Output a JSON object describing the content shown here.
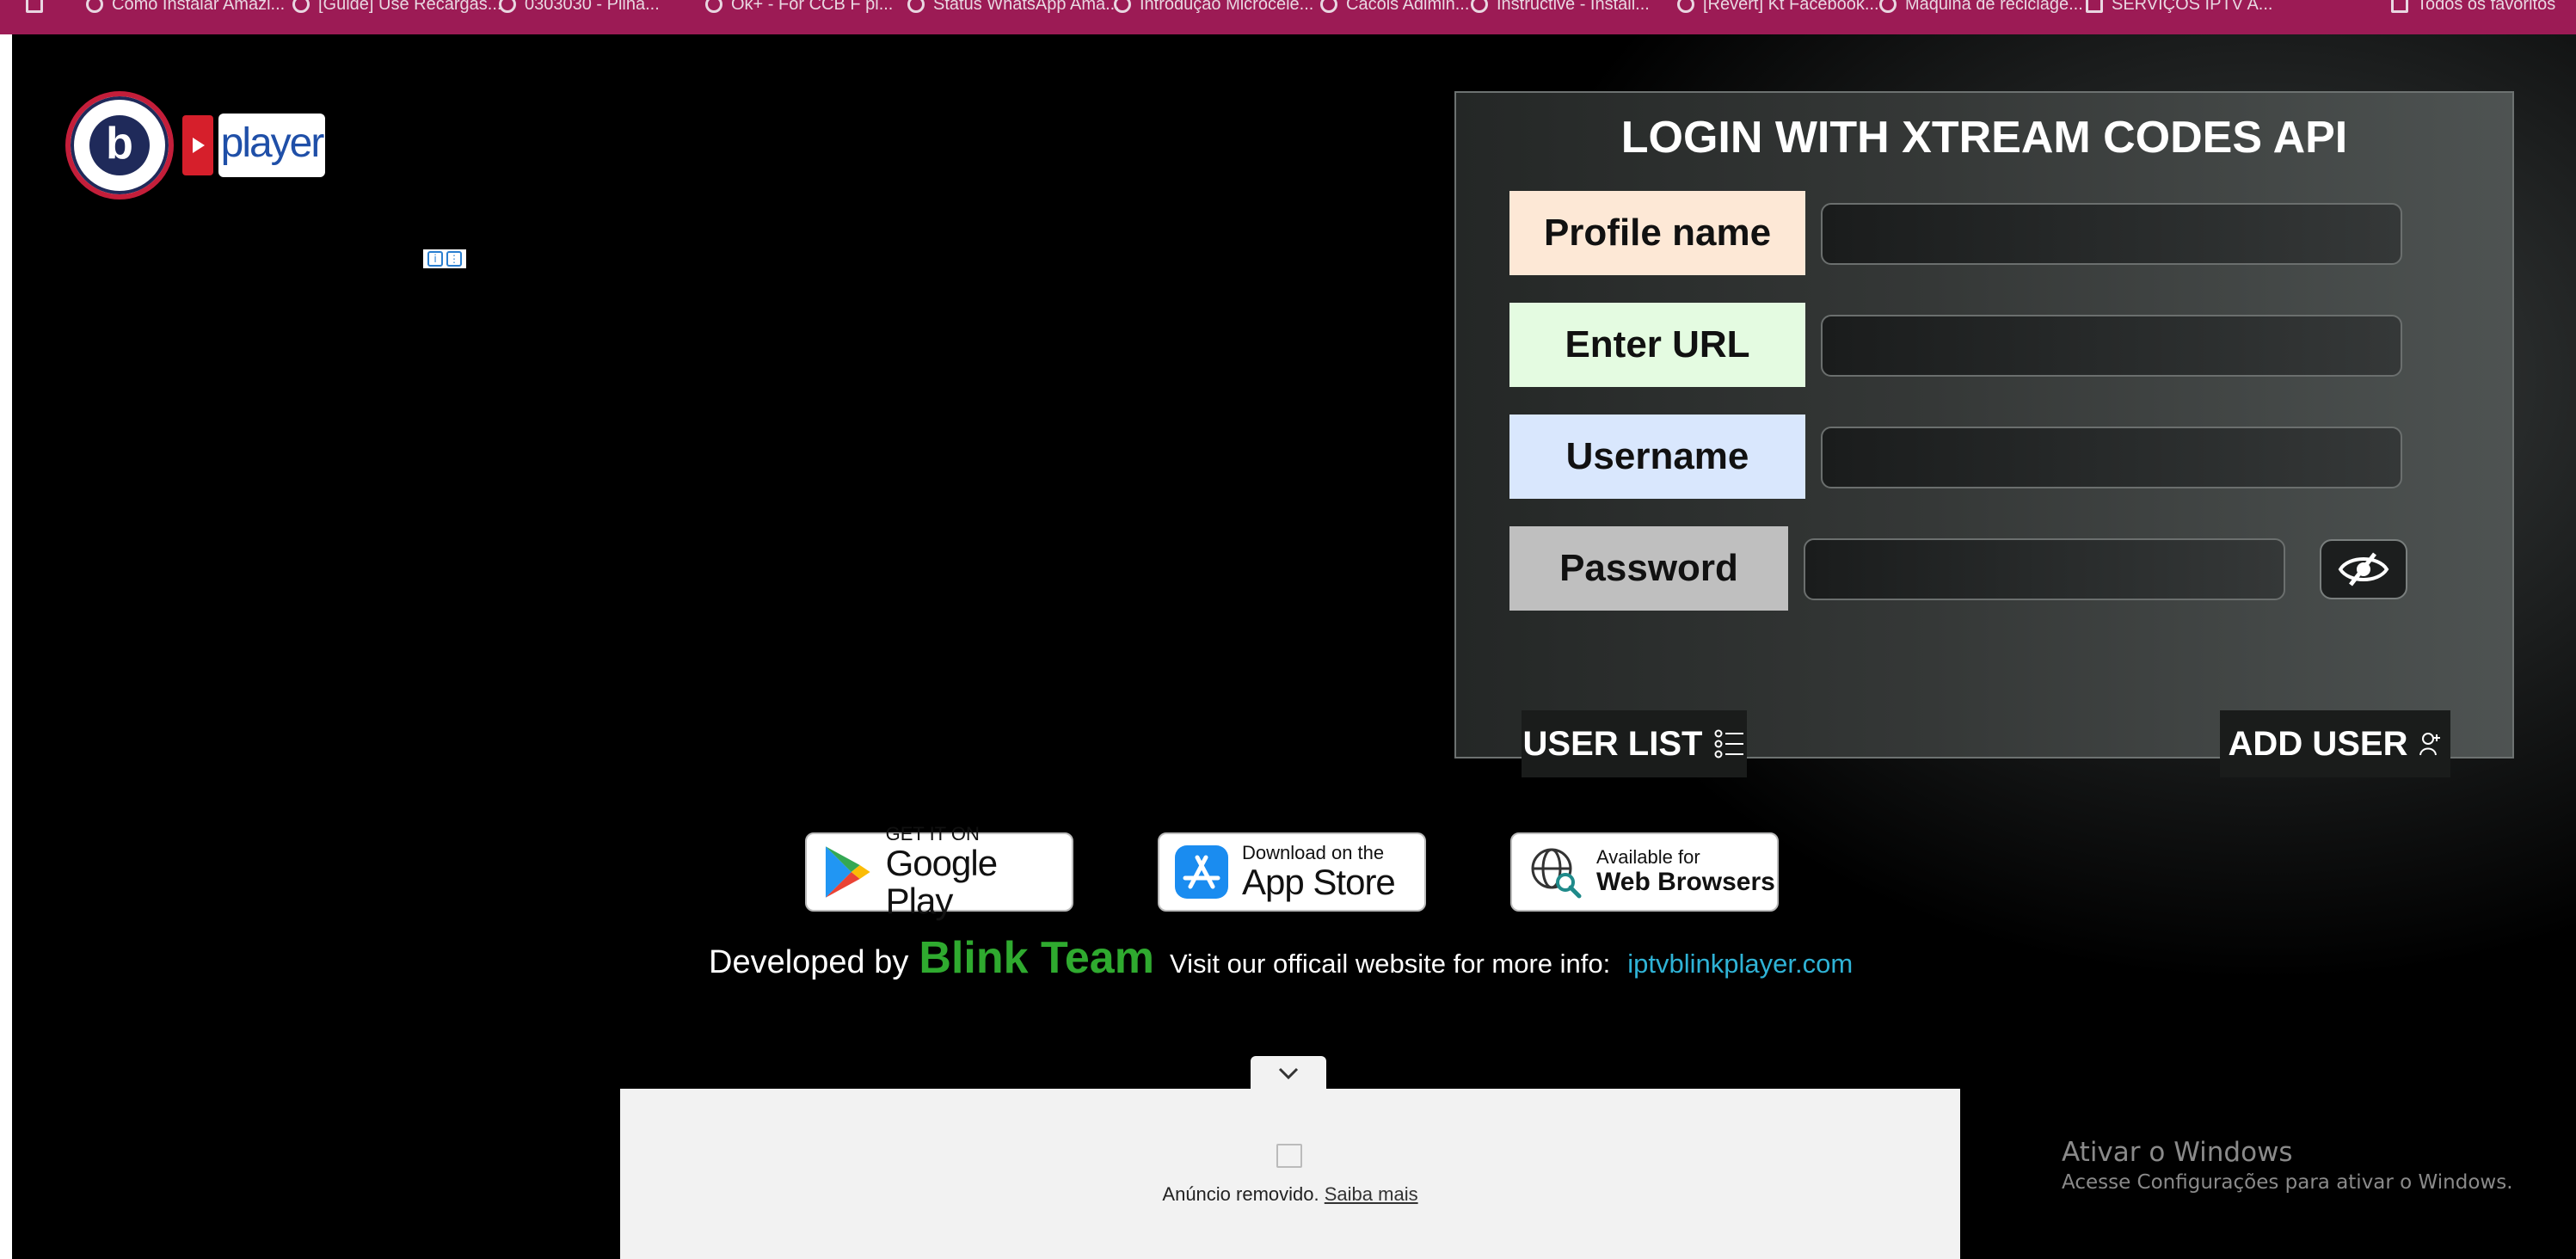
{
  "bookmarks": [
    {
      "label": "Como Instalar Amazi..."
    },
    {
      "label": "[Guide] Use Recargas..."
    },
    {
      "label": "0303030 - Pilha..."
    },
    {
      "label": "Ok+ - For CCB F pl..."
    },
    {
      "label": "Status WhatsApp Ama..."
    },
    {
      "label": "Introdução Microcele..."
    },
    {
      "label": "Cacols Adimin..."
    },
    {
      "label": "Instructive - Install..."
    },
    {
      "label": "[Revert] Kt Facebook..."
    },
    {
      "label": "Máquina de reciclage..."
    },
    {
      "label": "SERVIÇOS IPTV A..."
    },
    {
      "label": "Todos os favoritos"
    }
  ],
  "logo": {
    "letter": "b",
    "word": "player"
  },
  "login": {
    "title": "LOGIN WITH XTREAM CODES API",
    "fields": [
      {
        "label": "Profile name",
        "value": "",
        "color": "#fde8d6"
      },
      {
        "label": "Enter URL",
        "value": "",
        "color": "#e4fbe1"
      },
      {
        "label": "Username",
        "value": "",
        "color": "#d9e7fd"
      },
      {
        "label": "Password",
        "value": "",
        "color": "#bfbfbf"
      }
    ],
    "password_toggle_icon": "eye-slash-icon",
    "user_list_label": "USER LIST",
    "add_user_label": "ADD USER"
  },
  "stores": [
    {
      "small": "GET IT ON",
      "big": "Google Play",
      "icon": "google-play-icon"
    },
    {
      "small": "Download on the",
      "big": "App Store",
      "icon": "app-store-icon"
    },
    {
      "small": "Available for",
      "big": "Web Browsers",
      "icon": "globe-search-icon"
    }
  ],
  "footer": {
    "developed_by": "Developed by",
    "team": "Blink Team",
    "visit": "Visit our officail website for more info:",
    "website": "iptvblinkplayer.com",
    "team_color": "#2faa2f",
    "link_color": "#2fb3d6"
  },
  "ad": {
    "removed_text": "Anúncio removido.",
    "learn_more": "Saiba mais"
  },
  "watermark": {
    "title": "Ativar o Windows",
    "subtitle": "Acesse Configurações para ativar o Windows."
  }
}
